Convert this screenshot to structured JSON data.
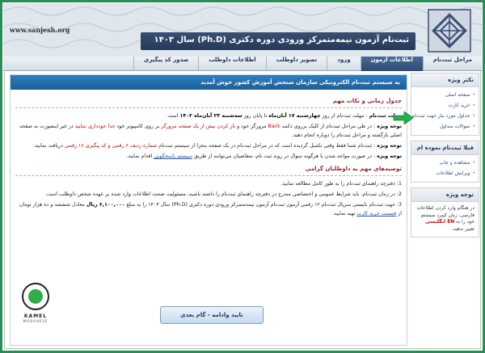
{
  "banner": {
    "site_url": "www.sanjesh.org",
    "title": "ثبت‌نام آزمون نیمه‌متمرکز ورودی دوره دکتری (Ph.D) سال ۱۴۰۳"
  },
  "nav": {
    "items": [
      {
        "label": "مراحل ثبت‌نام"
      },
      {
        "label": "اطلاعات آزمون",
        "active": true
      },
      {
        "label": "ورود"
      },
      {
        "label": "تصویر داوطلب"
      },
      {
        "label": "اطلاعات داوطلب"
      },
      {
        "label": "صدور کد پیگیری"
      }
    ]
  },
  "sidebar": {
    "steps": {
      "title": "نکتر ویژه",
      "items": [
        "صفحه اصلی",
        "خرید کارت",
        "جداول مورد نیاز جهت ثبت‌نام",
        "سوالات متداول"
      ]
    },
    "registered": {
      "title": "قبلا ثبت‌نام نموده ام",
      "items": [
        "مشاهده و چاپ",
        "ویرایش اطلاعات"
      ]
    },
    "notice": {
      "title": "توجه ویژه",
      "text": "در هنگام وارد کردن اطلاعات فارسی، زبان کیبرد سیستم خود را به",
      "highlight": "EN انگلیسی",
      "tail": "تغییر ندهید."
    }
  },
  "main": {
    "welcome": "به سیستم ثبت‌نام الکترونیکی سازمان سنجش آموزش کشور خوش آمدید",
    "schedule_title": "جدول زمانی و نکات مهم",
    "deadline_label": "مهلت ثبت‌نام",
    "deadline_text": ": مهلت ثبت‌نام از روز",
    "deadline_from": "چهارشنبه ۱۷ آبان‌ماه",
    "deadline_mid": "تا پایان روز",
    "deadline_to": "سه‌شنبه ۲۳ آبان‌ماه ۱۴۰۲",
    "deadline_end": "است",
    "note1_label": "توجه ویژه",
    "note1_text": ": در طی مراحل ثبت‌نام از کلیک برروی دکمه",
    "note1_back": "Back",
    "note1_text2": "مرورگر خود و",
    "note1_red": "باز کردن بیش از یک صفحه مرورگر",
    "note1_text3": "بر روی کامپیوتر خود",
    "note1_red2": "جدا خودداری نمایید",
    "note1_text4": "در غیر اینصورت به صفحه اصلی بازگشته و مراحل ثبت‌نام را دوباره انجام دهید.",
    "note2_label": "توجه ویژه",
    "note2_text": ": ثبت‌نام شما فقط وقتی تکمیل گردیده است که در مراحل ثبت‌نام در یک صفحه مجزا از سیستم ثبت‌نام",
    "note2_red": "شماره ردیف ۶ رقمی و کد پیگیری ۱۶ رقمی",
    "note2_text2": "دریافت نمایید.",
    "note3_label": "توجه ویژه",
    "note3_text": ": در صورت مواجه شدن با هرگونه سوال در روند ثبت نام، متقاضیان می‌توانند از طریق",
    "note3_link": "سیستم پاسخگویی",
    "note3_text2": "اقدام نمایند.",
    "tips_title": "توصیه‌های مهم به داوطلبان گرامی",
    "tip1": "1: دفترچه راهنمای ثبت‌نام را به طور کامل مطالعه نمایید.",
    "tip2": "2: در زمان ثبت‌نام، باید شرایط عمومی و اختصاصی مندرج در دفترچه راهنمای ثبت‌نام را داشته باشید، مسئولیت صحت اطلاعات وارد شده بر عهده شخص داوطلب است.",
    "tip3_text": "3: جهت ثبت‌نام بایستی سریال ثبت‌نام ۱۲ رقمی آزمون ثبت‌نام آزمون نیمه‌متمرکز ورودی دوره دکتری (Ph.D) سال ۱۴۰۳ را به مبلغ",
    "tip3_amount": "۶,۱۰۰,۰۰۰ ریال",
    "tip3_text2": "معادل ششصد و ده هزار تومان از",
    "tip3_link": "قسمت خرید کارت",
    "tip3_text3": "تهیه نمایید.",
    "confirm_button": "تایید وادامه - گام بعدی"
  },
  "watermark": {
    "name": "KAMEL",
    "sub": "MOBAHESE"
  },
  "colors": {
    "frame": "#2e8b57",
    "accent": "#1d5f99",
    "alert": "#cc0000"
  }
}
